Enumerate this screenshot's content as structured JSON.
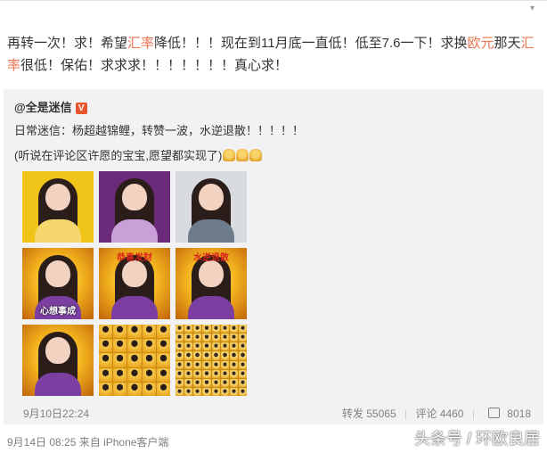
{
  "post": {
    "segments": [
      {
        "text": "再转一次！求！希望",
        "hl": false
      },
      {
        "text": "汇率",
        "hl": true
      },
      {
        "text": "降低！！！现在到11月底一直低！低至7.6一下！求换",
        "hl": false
      },
      {
        "text": "欧元",
        "hl": true
      },
      {
        "text": "那天",
        "hl": false
      },
      {
        "text": "汇率",
        "hl": true
      },
      {
        "text": "很低！保佑！求求求！！！！！！！真心求！",
        "hl": false
      }
    ],
    "dropdown_icon": "chevron-down-icon"
  },
  "retweet": {
    "author": "@全是迷信",
    "badge": "V",
    "text": "日常迷信：杨超越锦鲤，转赞一波，水逆退散！！！！！",
    "subtext": "(听说在评论区许愿的宝宝,愿望都实现了)",
    "photos": [
      {
        "type": "photo",
        "bg": "#f0c419",
        "body": "#f5d76e"
      },
      {
        "type": "photo",
        "bg": "#6b2b7a",
        "body": "#c9a0d8"
      },
      {
        "type": "photo",
        "bg": "#d8dbe0",
        "body": "#6e7b8a"
      },
      {
        "type": "gold",
        "top": "",
        "bottom": "心想事成",
        "body": "#7a3fa0"
      },
      {
        "type": "gold",
        "top": "恭喜发财",
        "bottom": "",
        "body": "#7a3fa0"
      },
      {
        "type": "gold",
        "top": "水逆退散",
        "bottom": "",
        "body": "#7a3fa0"
      },
      {
        "type": "gold",
        "top": "",
        "bottom": "",
        "body": "#7a3fa0"
      },
      {
        "type": "tiles",
        "n": 5
      },
      {
        "type": "tiles2",
        "n": 8
      }
    ],
    "time": "9月10日22:24",
    "repost": "转发 55065",
    "comment": "评论 4460",
    "like": "8018"
  },
  "footer": {
    "time": "9月14日 08:25 来自 iPhone客户端"
  },
  "watermark": "头条号 / 环欧良居",
  "colors": {
    "highlight": "#eb7350",
    "panel": "#f2f2f5",
    "meta": "#808080"
  }
}
